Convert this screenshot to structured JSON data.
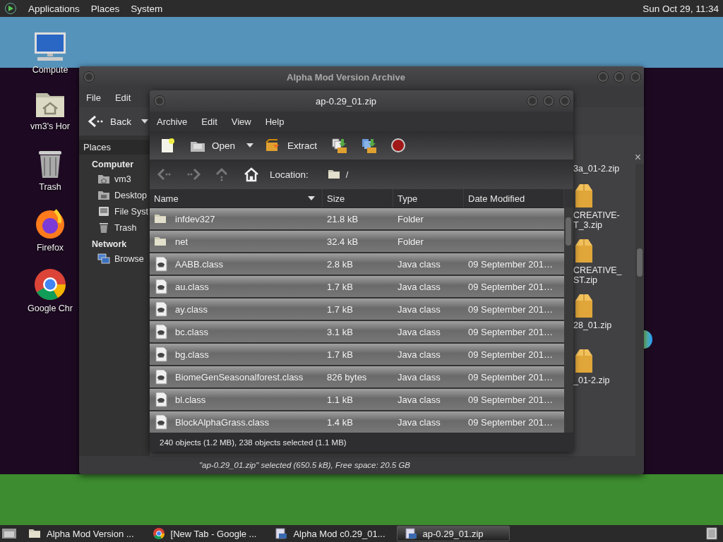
{
  "top_panel": {
    "menus": [
      "Applications",
      "Places",
      "System"
    ],
    "clock": "Sun Oct 29, 11:34"
  },
  "desktop_icons": [
    {
      "kind": "computer",
      "label": "Compute"
    },
    {
      "kind": "home",
      "label": "vm3's Hor"
    },
    {
      "kind": "trash",
      "label": "Trash"
    },
    {
      "kind": "firefox",
      "label": "Firefox"
    },
    {
      "kind": "chrome",
      "label": "Google Chr"
    }
  ],
  "file_manager": {
    "title": "Alpha Mod Version Archive",
    "menus": [
      "File",
      "Edit"
    ],
    "back_label": "Back",
    "sidebar_title": "Places",
    "sections": [
      {
        "title": "Computer",
        "items": [
          {
            "kind": "home",
            "label": "vm3"
          },
          {
            "kind": "desktop",
            "label": "Desktop"
          },
          {
            "kind": "drive",
            "label": "File Syst"
          },
          {
            "kind": "trash",
            "label": "Trash"
          }
        ]
      },
      {
        "title": "Network",
        "items": [
          {
            "kind": "network",
            "label": "Browse"
          }
        ]
      }
    ],
    "files": [
      {
        "label": "3a_01-2.zip",
        "icon": false
      },
      {
        "label": "CREATIVE-\nT_3.zip",
        "icon": true
      },
      {
        "label": "CREATIVE_\nST.zip",
        "icon": true
      },
      {
        "label": "28_01.zip",
        "icon": true
      },
      {
        "label": "_01-2.zip",
        "icon": true
      }
    ],
    "close": "×",
    "status": "\"ap-0.29_01.zip\" selected (650.5 kB), Free space: 20.5 GB"
  },
  "archive": {
    "title": "ap-0.29_01.zip",
    "menus": [
      "Archive",
      "Edit",
      "View",
      "Help"
    ],
    "toolbar": [
      {
        "kind": "new"
      },
      {
        "kind": "open",
        "label": "Open"
      },
      {
        "kind": "extract",
        "label": "Extract"
      },
      {
        "kind": "add-files"
      },
      {
        "kind": "add-folder"
      },
      {
        "kind": "stop"
      }
    ],
    "nav": [
      {
        "kind": "back",
        "disabled": true
      },
      {
        "kind": "forward",
        "disabled": true
      },
      {
        "kind": "up",
        "disabled": true
      },
      {
        "kind": "home",
        "disabled": false
      }
    ],
    "location_label": "Location:",
    "location": "/",
    "columns": [
      "Name",
      "Size",
      "Type",
      "Date Modified"
    ],
    "rows": [
      {
        "kind": "folder",
        "name": "infdev327",
        "size": "21.8 kB",
        "type": "Folder",
        "date": "",
        "selected": true
      },
      {
        "kind": "folder",
        "name": "net",
        "size": "32.4 kB",
        "type": "Folder",
        "date": "",
        "selected": true
      },
      {
        "kind": "class",
        "name": "AABB.class",
        "size": "2.8 kB",
        "type": "Java class",
        "date": "09 September 201…",
        "selected": true
      },
      {
        "kind": "class",
        "name": "au.class",
        "size": "1.7 kB",
        "type": "Java class",
        "date": "09 September 201…",
        "selected": true
      },
      {
        "kind": "class",
        "name": "ay.class",
        "size": "1.7 kB",
        "type": "Java class",
        "date": "09 September 201…",
        "selected": true
      },
      {
        "kind": "class",
        "name": "bc.class",
        "size": "3.1 kB",
        "type": "Java class",
        "date": "09 September 201…",
        "selected": true
      },
      {
        "kind": "class",
        "name": "bg.class",
        "size": "1.7 kB",
        "type": "Java class",
        "date": "09 September 201…",
        "selected": true
      },
      {
        "kind": "class",
        "name": "BiomeGenSeasonalforest.class",
        "size": "826 bytes",
        "type": "Java class",
        "date": "09 September 201…",
        "selected": true
      },
      {
        "kind": "class",
        "name": "bl.class",
        "size": "1.1 kB",
        "type": "Java class",
        "date": "09 September 201…",
        "selected": true
      },
      {
        "kind": "class",
        "name": "BlockAlphaGrass.class",
        "size": "1.4 kB",
        "type": "Java class",
        "date": "09 September 201…",
        "selected": true
      }
    ],
    "status": "240 objects (1.2 MB), 238 objects selected (1.1 MB)"
  },
  "taskbar": {
    "items": [
      {
        "kind": "folder",
        "label": "Alpha Mod Version ...",
        "selected": false
      },
      {
        "kind": "chrome",
        "label": "[New Tab - Google ...",
        "selected": false
      },
      {
        "kind": "archive",
        "label": "Alpha Mod c0.29_01...",
        "selected": false
      },
      {
        "kind": "archive",
        "label": "ap-0.29_01.zip",
        "selected": true
      }
    ]
  }
}
